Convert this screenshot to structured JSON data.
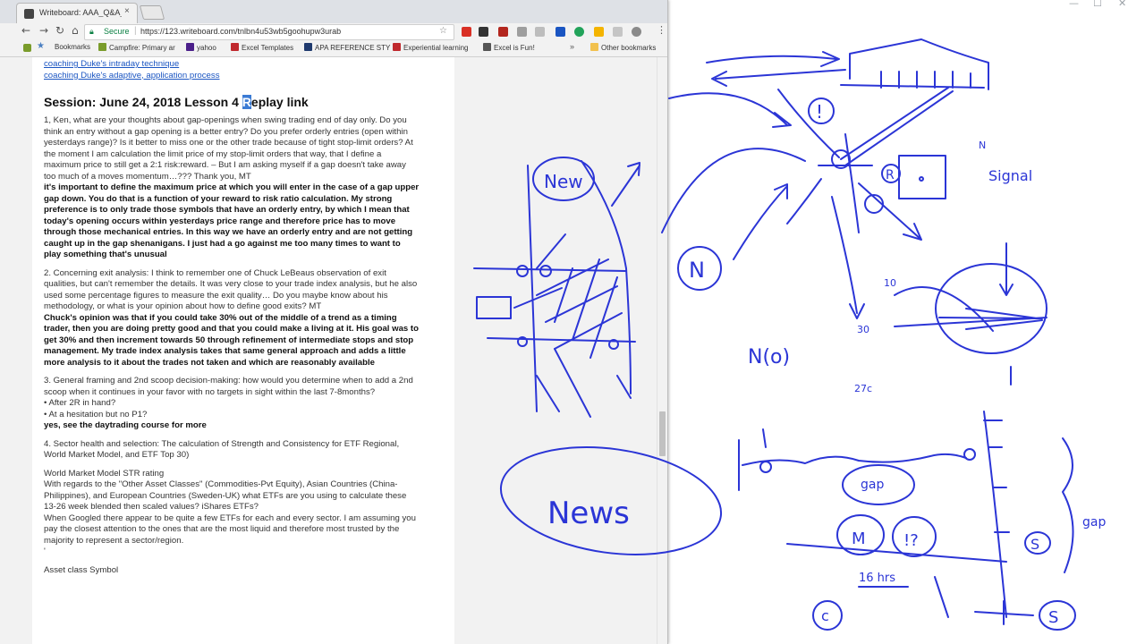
{
  "browser": {
    "tab_title": "Writeboard: AAA_Q&A_s",
    "tab_close": "×",
    "secure_label": "Secure",
    "url": "https://123.writeboard.com/tnlbn4u53wb5goohupw3urab",
    "bookmarks": [
      {
        "label": "Bookmarks",
        "icon": "star-icon",
        "color": "#4a7fc1"
      },
      {
        "label": "Campfire: Primary ar",
        "icon": "campfire-icon",
        "color": "#7a9c2b"
      },
      {
        "label": "yahoo",
        "icon": "yahoo-icon",
        "color": "#4b1f8a"
      },
      {
        "label": "Excel Templates",
        "icon": "excel-templates-icon",
        "color": "#c0282d"
      },
      {
        "label": "APA REFERENCE STY",
        "icon": "apa-icon",
        "color": "#1f3a6e"
      },
      {
        "label": "Experiential learning",
        "icon": "experiential-icon",
        "color": "#c0282d"
      },
      {
        "label": "Excel is Fun!",
        "icon": "excel-fun-icon",
        "color": "#555555"
      }
    ],
    "bookmarks_overflow": "»",
    "other_bookmarks": "Other bookmarks"
  },
  "document": {
    "links": [
      "coaching Duke's intraday technique",
      "coaching Duke's adaptive, application process"
    ],
    "session_title_before": "Session: June 24, 2018 Lesson 4 ",
    "session_title_highlight": "R",
    "session_title_after": "eplay link",
    "q1": "1, Ken, what are your thoughts about gap-openings when swing trading end of day only. Do you think an entry without a gap opening is a better entry? Do you prefer orderly entries (open within yesterdays range)? Is it better to miss one or the other trade because of tight stop-limit orders? At the moment I am calculation the limit price of my stop-limit orders that way, that I define a maximum price to still get a 2:1 risk:reward. – But I am asking myself if a gap doesn't take away too much of a moves momentum…??? Thank you, MT",
    "a1": "it's important to define the maximum price at which you will enter in the case of a gap upper gap down. You do that is a function of your reward to risk ratio calculation. My strong preference is to only trade those symbols that have an orderly entry, by which I mean that today's opening occurs within yesterdays price range and therefore price has to move through those mechanical entries. In this way we have an orderly entry and are not getting caught up in the gap shenanigans. I just had a go against me too many times to want to play something that's unusual",
    "q2": "2. Concerning exit analysis: I think to remember one of Chuck LeBeaus observation of exit qualities, but can't remember the details. It was very close to your trade index analysis, but he also used some percentage figures to measure the exit quality… Do you maybe know about his methodology, or what is your opinion about how to define good exits? MT",
    "a2": "Chuck's opinion was that if you could take 30% out of the middle of a trend as a timing trader, then you are doing pretty good and that you could make a living at it. His goal was to get 30% and then increment towards 50 through refinement of intermediate stops and stop management. My trade index analysis takes that same general approach and adds a little more analysis to it about the trades not taken and which are reasonably available",
    "q3": "3. General framing and 2nd scoop decision-making: how would you determine when to add a 2nd scoop when it continues in your favor with no targets in sight within the last 7-8months?",
    "q3_b1": "• After 2R in hand?",
    "q3_b2": "• At a hesitation but no P1?",
    "a3": "yes, see the daytrading course for more",
    "q4": "4. Sector health and selection: The calculation of Strength and Consistency for ETF Regional, World Market Model, and ETF Top 30)",
    "q4_sub": "World Market Model STR rating",
    "q4_p1": "With regards to the \"Other Asset Classes\" (Commodities-Pvt Equity), Asian Countries (China-Philippines), and European Countries (Sweden-UK) what ETFs are you using to calculate these 13-26 week blended then scaled values? iShares ETFs?",
    "q4_p2": "When Googled there appear to be quite a few ETFs for each and every sector. I am assuming you pay the closest attention to the ones that are the most liquid and therefore most trusted by the majority to represent a sector/region.",
    "q4_tick": "'",
    "asset_heading": "Asset class Symbol"
  },
  "whiteboard": {
    "labels": {
      "new": "New",
      "news": "News",
      "signal": "Signal",
      "gap_circle": "gap",
      "gap_side": "gap",
      "n_circle": "N",
      "n_small": "N",
      "n_paren": "N(o)",
      "m_circle": "M",
      "question_circle": "!?",
      "r_circle": "R",
      "excl": "!",
      "s1": "S",
      "s2": "S",
      "c": "c",
      "tick_30": "30",
      "tick_10": "10",
      "tick_27": "27c",
      "h16": "16 hrs"
    }
  },
  "colors": {
    "ink": "#2b35d6",
    "link": "#1a55c2",
    "highlight": "#3b7bd4",
    "secure": "#0b8043"
  }
}
